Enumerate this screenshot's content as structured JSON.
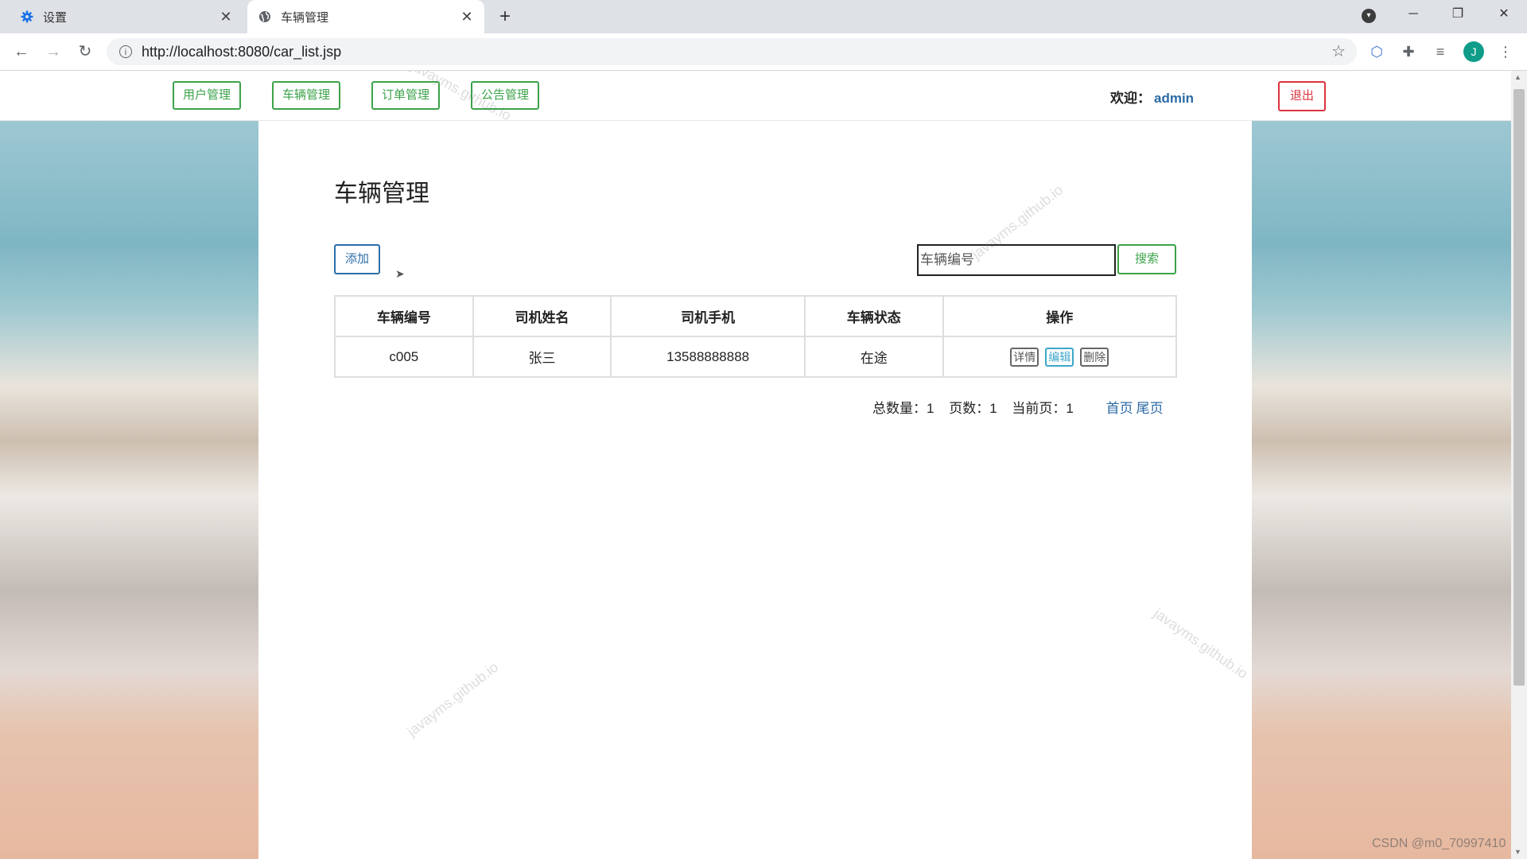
{
  "browser": {
    "tabs": [
      {
        "title": "设置",
        "icon": "gear-icon",
        "active": false
      },
      {
        "title": "车辆管理",
        "icon": "globe-icon",
        "active": true
      }
    ],
    "url": "http://localhost:8080/car_list.jsp",
    "profile_initial": "J"
  },
  "nav": {
    "links": [
      "用户管理",
      "车辆管理",
      "订单管理",
      "公告管理"
    ],
    "welcome_label": "欢迎：",
    "username": "admin",
    "logout_label": "退出"
  },
  "page": {
    "title": "车辆管理",
    "add_label": "添加",
    "search_placeholder": "车辆编号",
    "search_label": "搜索"
  },
  "table": {
    "headers": [
      "车辆编号",
      "司机姓名",
      "司机手机",
      "车辆状态",
      "操作"
    ],
    "rows": [
      {
        "car_no": "c005",
        "driver_name": "张三",
        "driver_phone": "13588888888",
        "status": "在途"
      }
    ],
    "actions": {
      "detail": "详情",
      "edit": "编辑",
      "delete": "删除"
    }
  },
  "pager": {
    "total": "总数量：1",
    "pages": "页数：1",
    "current": "当前页：1",
    "first": "首页",
    "last": "尾页"
  },
  "watermark_text": "javayms.github.io",
  "footer_watermark": "CSDN @m0_70997410"
}
